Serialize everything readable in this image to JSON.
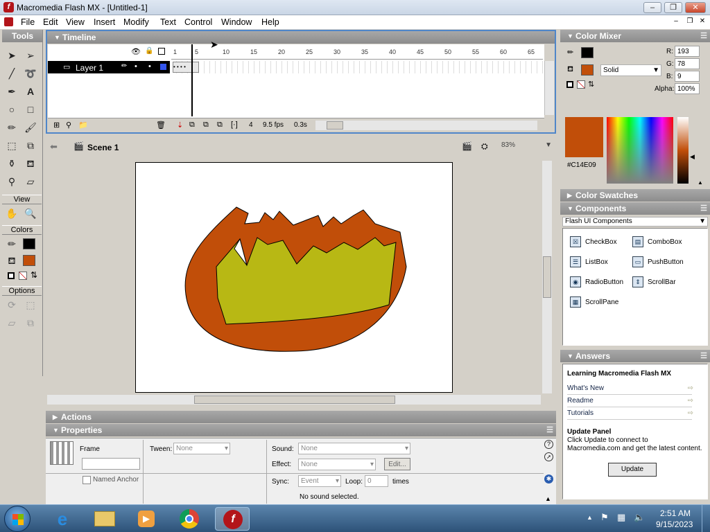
{
  "window": {
    "title": "Macromedia Flash MX - [Untitled-1]"
  },
  "menu": [
    "File",
    "Edit",
    "View",
    "Insert",
    "Modify",
    "Text",
    "Control",
    "Window",
    "Help"
  ],
  "tools": {
    "header": "Tools",
    "view_label": "View",
    "colors_label": "Colors",
    "options_label": "Options"
  },
  "timeline": {
    "header": "Timeline",
    "ruler": [
      "1",
      "5",
      "10",
      "15",
      "20",
      "25",
      "30",
      "35",
      "40",
      "45",
      "50",
      "55",
      "60",
      "65"
    ],
    "layer_name": "Layer 1",
    "current_frame": "4",
    "fps": "9.5 fps",
    "elapsed": "0.3s"
  },
  "stage": {
    "scene_label": "Scene 1",
    "zoom": "83%"
  },
  "actions": {
    "header": "Actions"
  },
  "properties": {
    "header": "Properties",
    "frame_label": "Frame",
    "tween_label": "Tween:",
    "tween_value": "None",
    "sound_label": "Sound:",
    "sound_value": "None",
    "effect_label": "Effect:",
    "effect_value": "None",
    "edit_button": "Edit...",
    "sync_label": "Sync:",
    "sync_value": "Event",
    "loop_label": "Loop:",
    "loop_value": "0",
    "times_label": "times",
    "no_sound": "No sound selected.",
    "named_anchor": "Named Anchor"
  },
  "color_mixer": {
    "header": "Color Mixer",
    "r_label": "R:",
    "r_value": "193",
    "g_label": "G:",
    "g_value": "78",
    "b_label": "B:",
    "b_value": "9",
    "alpha_label": "Alpha:",
    "alpha_value": "100%",
    "fill_type": "Solid",
    "hex": "#C14E09",
    "fill_color": "#c14e09",
    "stroke_color": "#000000"
  },
  "color_swatches": {
    "header": "Color Swatches"
  },
  "components": {
    "header": "Components",
    "set": "Flash UI Components",
    "items": [
      "CheckBox",
      "ComboBox",
      "ListBox",
      "PushButton",
      "RadioButton",
      "ScrollBar",
      "ScrollPane"
    ]
  },
  "answers": {
    "header": "Answers",
    "title": "Learning Macromedia Flash MX",
    "links": [
      "What's New",
      "Readme",
      "Tutorials"
    ],
    "update_title": "Update Panel",
    "update_text": "Click Update to connect to Macromedia.com and get the latest content.",
    "update_button": "Update"
  },
  "taskbar": {
    "time": "2:51 AM",
    "date": "9/15/2023"
  },
  "drawing": {
    "outer_color": "#c14e09",
    "inner_color": "#b8b814"
  }
}
